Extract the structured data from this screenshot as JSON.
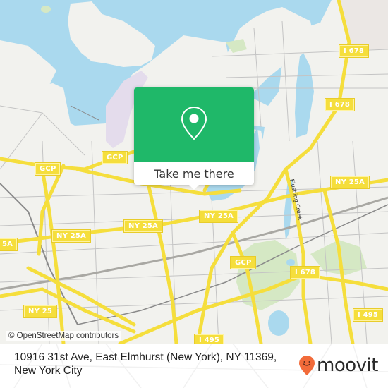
{
  "map": {
    "colors": {
      "land": "#f2f2ee",
      "water": "#aad9ee",
      "park": "#d5e8c4",
      "road_major": "#f5de3c",
      "road_minor": "#bdbdbd",
      "rail": "#8a8a8a",
      "airport": "#e4dcec"
    },
    "road_shields": [
      {
        "id": "gcp-1",
        "label": "GCP"
      },
      {
        "id": "gcp-2",
        "label": "GCP"
      },
      {
        "id": "gcp-3",
        "label": "GCP"
      },
      {
        "id": "i678-1",
        "label": "I 678"
      },
      {
        "id": "i678-2",
        "label": "I 678"
      },
      {
        "id": "i678-3",
        "label": "I 678"
      },
      {
        "id": "i678-4",
        "label": "I 678"
      },
      {
        "id": "ny25a-1",
        "label": "NY 25A"
      },
      {
        "id": "ny25a-2",
        "label": "NY 25A"
      },
      {
        "id": "ny25a-3",
        "label": "NY 25A"
      },
      {
        "id": "ny25a-4",
        "label": "NY 25A"
      },
      {
        "id": "ny25a-5",
        "label": "5A"
      },
      {
        "id": "ny25",
        "label": "NY 25"
      },
      {
        "id": "i495-1",
        "label": "I 495"
      },
      {
        "id": "i495-2",
        "label": "I 495"
      }
    ],
    "water_labels": [
      {
        "label": "Flushing Creek"
      }
    ],
    "attribution": "© OpenStreetMap contributors"
  },
  "popup": {
    "icon": "map-pin-icon",
    "button_label": "Take me there",
    "accent_color": "#1fb869"
  },
  "footer": {
    "address": "10916 31st Ave, East Elmhurst (New York), NY 11369, New York City",
    "brand": {
      "name": "moovit",
      "icon": "moovit-pin-smile-icon",
      "color": "#f26b3a"
    }
  }
}
